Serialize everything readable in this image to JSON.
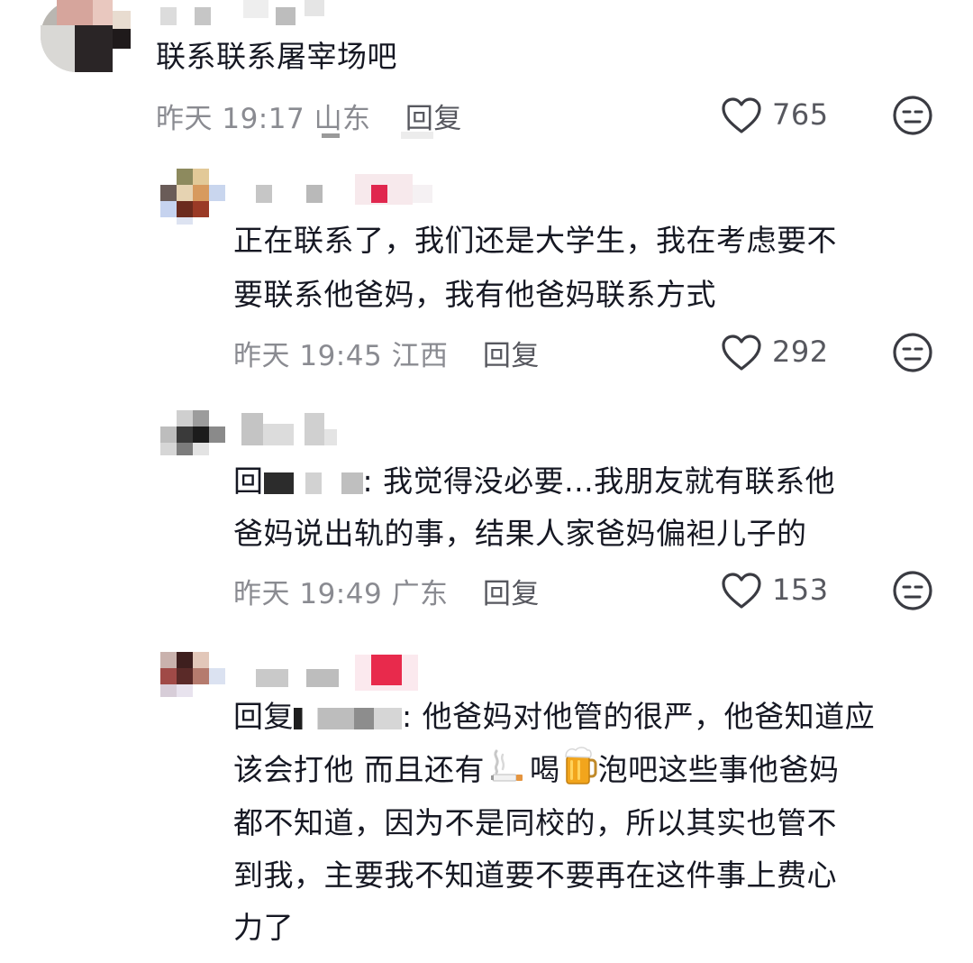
{
  "comments": [
    {
      "text_lines": [
        "联系联系屠宰场吧"
      ],
      "time": "昨天 19:17",
      "location": "山东",
      "reply_label": "回复",
      "likes": "765"
    },
    {
      "text_lines": [
        "正在联系了，我们还是大学生，我在考虑要不",
        "要联系他爸妈，我有他爸妈联系方式"
      ],
      "time": "昨天 19:45",
      "location": "江西",
      "reply_label": "回复",
      "likes": "292"
    },
    {
      "reply_prefix": "回",
      "text_line1_rest": ": 我觉得没必要...我朋友就有联系他",
      "text_line2": "爸妈说出轨的事，结果人家爸妈偏袒儿子的",
      "time": "昨天 19:49",
      "location": "广东",
      "reply_label": "回复",
      "likes": "153"
    },
    {
      "reply_prefix": "回复",
      "text_line1_rest": ": 他爸妈对他管的很严，他爸知道应",
      "text_line2_a": "该会打他 而且还有",
      "text_line2_b": "喝",
      "text_line2_c": "泡吧这些事他爸妈",
      "text_line3": "都不知道，因为不是同校的，所以其实也管不",
      "text_line4": "到我，主要我不知道要不要再在这件事上费心",
      "text_line5": "力了"
    }
  ],
  "icons": {
    "like": "heart-outline-icon",
    "dislike": "neutral-face-icon",
    "emoji_smoking": "cigarette-emoji",
    "emoji_beer": "beer-mug-emoji"
  },
  "colors": {
    "text": "#161823",
    "meta": "#8a8b91",
    "action": "#57585f"
  }
}
